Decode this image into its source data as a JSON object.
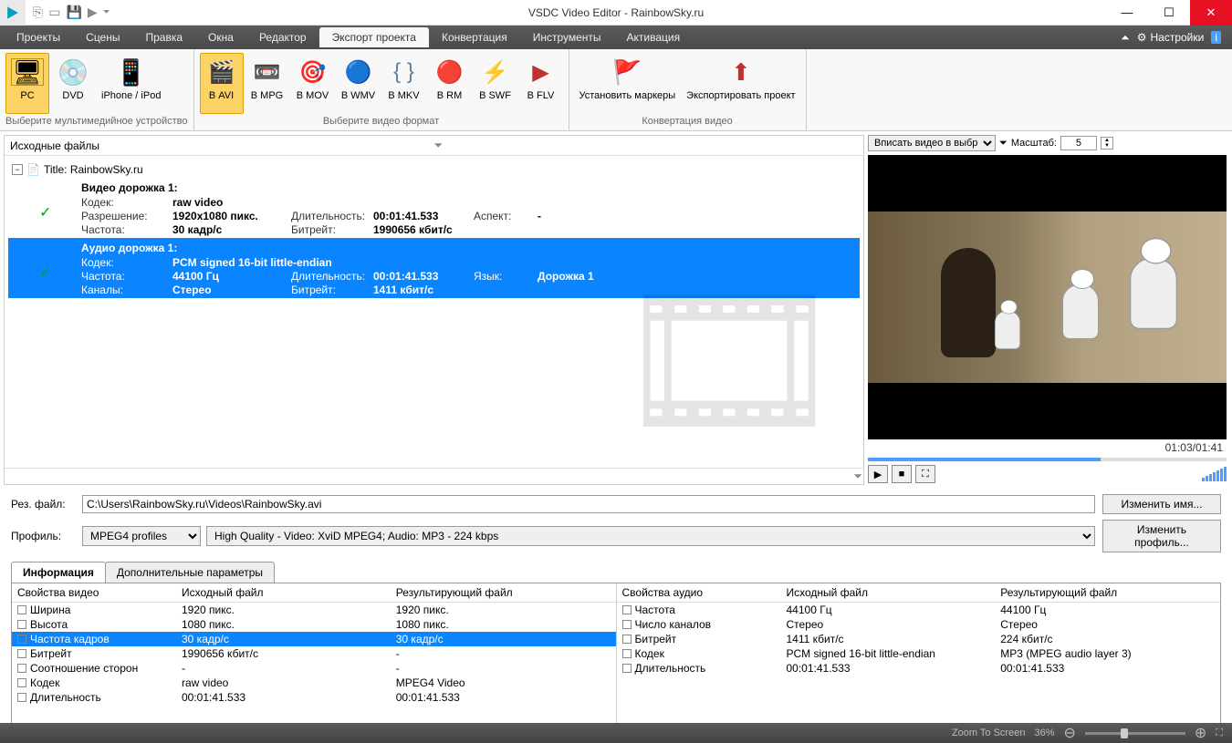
{
  "title": "VSDC Video Editor - RainbowSky.ru",
  "menubar": {
    "items": [
      "Проекты",
      "Сцены",
      "Правка",
      "Окна",
      "Редактор",
      "Экспорт проекта",
      "Конвертация",
      "Инструменты",
      "Активация"
    ],
    "active": 5,
    "settings": "Настройки"
  },
  "ribbon": {
    "group1": {
      "title": "Выберите мультимедийное устройство",
      "items": [
        "PC",
        "DVD",
        "iPhone / iPod"
      ]
    },
    "group2": {
      "title": "Выберите видео формат",
      "items": [
        "В AVI",
        "В MPG",
        "В MOV",
        "В WMV",
        "В MKV",
        "В RM",
        "В SWF",
        "В FLV"
      ]
    },
    "group3": {
      "title": "Конвертация видео",
      "items": [
        "Установить маркеры",
        "Экспортировать проект"
      ]
    }
  },
  "left_panel": {
    "title": "Исходные файлы",
    "node_title": "Title: RainbowSky.ru",
    "video": {
      "head": "Видео дорожка 1:",
      "codec_l": "Кодек:",
      "codec": "raw video",
      "res_l": "Разрешение:",
      "res": "1920x1080 пикс.",
      "dur_l": "Длительность:",
      "dur": "00:01:41.533",
      "asp_l": "Аспект:",
      "asp": "-",
      "freq_l": "Частота:",
      "freq": "30 кадр/с",
      "bit_l": "Битрейт:",
      "bit": "1990656 кбит/с"
    },
    "audio": {
      "head": "Аудио дорожка 1:",
      "codec_l": "Кодек:",
      "codec": "PCM signed 16-bit little-endian",
      "freq_l": "Частота:",
      "freq": "44100 Гц",
      "dur_l": "Длительность:",
      "dur": "00:01:41.533",
      "lang_l": "Язык:",
      "lang": "Дорожка 1",
      "ch_l": "Каналы:",
      "ch": "Стерео",
      "bit_l": "Битрейт:",
      "bit": "1411 кбит/с"
    }
  },
  "preview": {
    "fit": "Вписать видео в выбр. р",
    "scale_l": "Масштаб:",
    "scale": "5",
    "time": "01:03/01:41"
  },
  "form": {
    "file_l": "Рез. файл:",
    "file": "C:\\Users\\RainbowSky.ru\\Videos\\RainbowSky.avi",
    "change_name": "Изменить имя...",
    "profile_l": "Профиль:",
    "profile1": "MPEG4 profiles",
    "profile2": "High Quality - Video: XviD MPEG4; Audio: MP3 - 224 kbps",
    "change_profile": "Изменить профиль..."
  },
  "tabs": [
    "Информация",
    "Дополнительные параметры"
  ],
  "props_video": {
    "head": [
      "Свойства видео",
      "Исходный файл",
      "Результирующий файл"
    ],
    "rows": [
      {
        "n": "Ширина",
        "s": "1920 пикс.",
        "r": "1920 пикс."
      },
      {
        "n": "Высота",
        "s": "1080 пикс.",
        "r": "1080 пикс."
      },
      {
        "n": "Частота кадров",
        "s": "30 кадр/с",
        "r": "30 кадр/с",
        "sel": true
      },
      {
        "n": "Битрейт",
        "s": "1990656 кбит/с",
        "r": "-"
      },
      {
        "n": "Соотношение сторон",
        "s": "-",
        "r": "-"
      },
      {
        "n": "Кодек",
        "s": "raw video",
        "r": "MPEG4 Video"
      },
      {
        "n": "Длительность",
        "s": "00:01:41.533",
        "r": "00:01:41.533"
      }
    ]
  },
  "props_audio": {
    "head": [
      "Свойства аудио",
      "Исходный файл",
      "Результирующий файл"
    ],
    "rows": [
      {
        "n": "Частота",
        "s": "44100 Гц",
        "r": "44100 Гц"
      },
      {
        "n": "Число каналов",
        "s": "Стерео",
        "r": "Стерео"
      },
      {
        "n": "Битрейт",
        "s": "1411 кбит/с",
        "r": "224 кбит/с"
      },
      {
        "n": "Кодек",
        "s": "PCM signed 16-bit little-endian",
        "r": "MP3 (MPEG audio layer 3)"
      },
      {
        "n": "Длительность",
        "s": "00:01:41.533",
        "r": "00:01:41.533"
      }
    ]
  },
  "status": {
    "zoom_l": "Zoom To Screen",
    "zoom": "36%"
  }
}
